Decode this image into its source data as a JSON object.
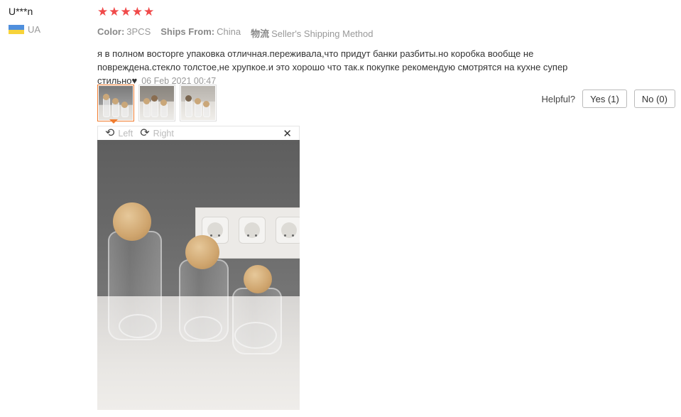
{
  "user": {
    "name": "U***n",
    "country_code": "UA"
  },
  "rating": {
    "stars": 5,
    "star_glyph": "★",
    "star_color": "#f04a4a"
  },
  "meta": {
    "color_label": "Color:",
    "color_value": "3PCS",
    "ships_label": "Ships From:",
    "ships_value": "China",
    "shipping_label": "物流",
    "shipping_value": "Seller's Shipping Method"
  },
  "review": {
    "text": "я в полном восторге упаковка отличная.переживала,что придут банки разбиты.но коробка вообще не повреждена.стекло толстое,не хрупкое.и это хорошо что так.к покупке рекомендую смотрятся на кухне супер стильно♥",
    "date": "06 Feb 2021 00:47"
  },
  "thumbnails": {
    "count": 3,
    "active_index": 0
  },
  "helpful": {
    "label": "Helpful?",
    "yes_label": "Yes (1)",
    "no_label": "No (0)"
  },
  "viewer": {
    "rotate_left_label": "Left",
    "rotate_right_label": "Right",
    "close_glyph": "✕",
    "rotate_left_icon": "rotate-left-icon",
    "rotate_right_icon": "rotate-right-icon"
  },
  "colors": {
    "accent": "#f07c2f",
    "flag_blue": "#4f8fdd",
    "flag_yellow": "#f7d33a"
  }
}
